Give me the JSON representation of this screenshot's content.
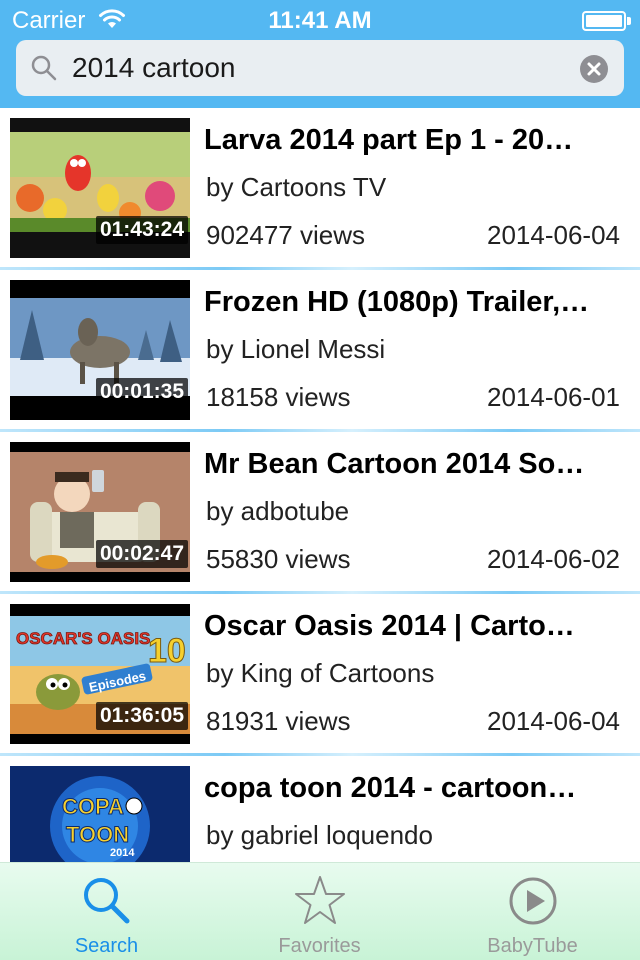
{
  "status_bar": {
    "carrier": "Carrier",
    "time": "11:41 AM"
  },
  "search": {
    "query": "2014 cartoon"
  },
  "results": [
    {
      "title": "Larva 2014 part Ep 1 - 20…",
      "author": "by Cartoons TV",
      "views": "902477 views",
      "date": "2014-06-04",
      "duration": "01:43:24"
    },
    {
      "title": "Frozen HD (1080p) Trailer,…",
      "author": "by Lionel Messi",
      "views": "18158 views",
      "date": "2014-06-01",
      "duration": "00:01:35"
    },
    {
      "title": "Mr Bean Cartoon 2014 So…",
      "author": "by adbotube",
      "views": "55830 views",
      "date": "2014-06-02",
      "duration": "00:02:47"
    },
    {
      "title": "Oscar Oasis 2014 | Carto…",
      "author": "by King of Cartoons",
      "views": "81931 views",
      "date": "2014-06-04",
      "duration": "01:36:05"
    },
    {
      "title": "copa toon 2014 - cartoon…",
      "author": "by gabriel loquendo",
      "views": "",
      "date": "",
      "duration": ""
    }
  ],
  "thumb_text": {
    "oscar": "OSCAR'S OASIS",
    "episodes": "Episodes",
    "episode_num": "10",
    "copa": "COPA",
    "toon": "TOON",
    "year": "2014"
  },
  "tabs": [
    {
      "label": "Search",
      "icon": "search-icon",
      "active": true
    },
    {
      "label": "Favorites",
      "icon": "star-icon",
      "active": false
    },
    {
      "label": "BabyTube",
      "icon": "play-circle-icon",
      "active": false
    }
  ],
  "colors": {
    "header": "#54b8f2",
    "accent": "#1a8fe8",
    "tabbar": "#d4f6df"
  }
}
